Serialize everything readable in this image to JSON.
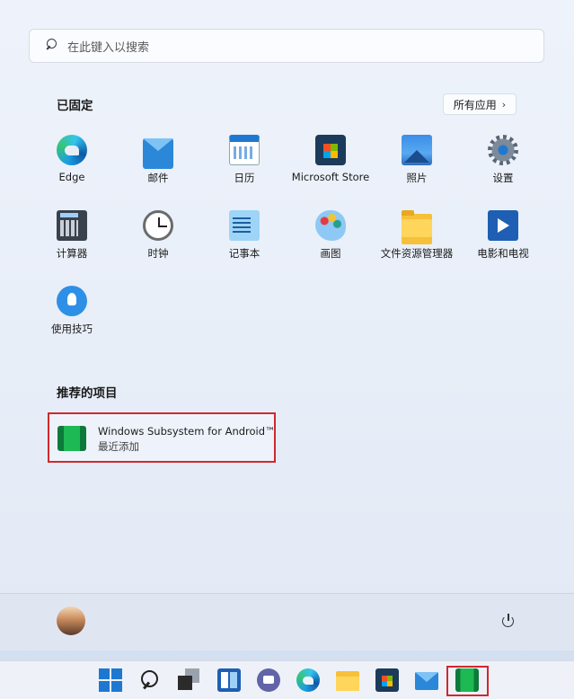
{
  "search": {
    "placeholder": "在此键入以搜索"
  },
  "pinned": {
    "title": "已固定",
    "all_apps_label": "所有应用",
    "apps": [
      {
        "label": "Edge",
        "icon": "edge-icon"
      },
      {
        "label": "邮件",
        "icon": "mail-icon"
      },
      {
        "label": "日历",
        "icon": "calendar-icon"
      },
      {
        "label": "Microsoft Store",
        "icon": "store-icon"
      },
      {
        "label": "照片",
        "icon": "photos-icon"
      },
      {
        "label": "设置",
        "icon": "gear-icon"
      },
      {
        "label": "计算器",
        "icon": "calculator-icon"
      },
      {
        "label": "时钟",
        "icon": "clock-icon"
      },
      {
        "label": "记事本",
        "icon": "notepad-icon"
      },
      {
        "label": "画图",
        "icon": "paint-icon"
      },
      {
        "label": "文件资源管理器",
        "icon": "folder-icon"
      },
      {
        "label": "电影和电视",
        "icon": "movies-icon"
      },
      {
        "label": "使用技巧",
        "icon": "tips-icon"
      }
    ]
  },
  "recommended": {
    "title": "推荐的项目",
    "items": [
      {
        "name": "Windows Subsystem for Android™",
        "subtitle": "最近添加",
        "icon": "android-subsystem-icon"
      }
    ]
  },
  "footer": {
    "user_icon": "avatar",
    "power_icon": "power-icon"
  },
  "taskbar": {
    "items": [
      "start-icon",
      "search-icon",
      "task-view-icon",
      "widgets-icon",
      "teams-chat-icon",
      "edge-icon",
      "file-explorer-icon",
      "store-icon",
      "mail-icon",
      "android-subsystem-icon"
    ]
  },
  "colors": {
    "highlight": "#d0282e",
    "accent": "#1e78d2"
  }
}
